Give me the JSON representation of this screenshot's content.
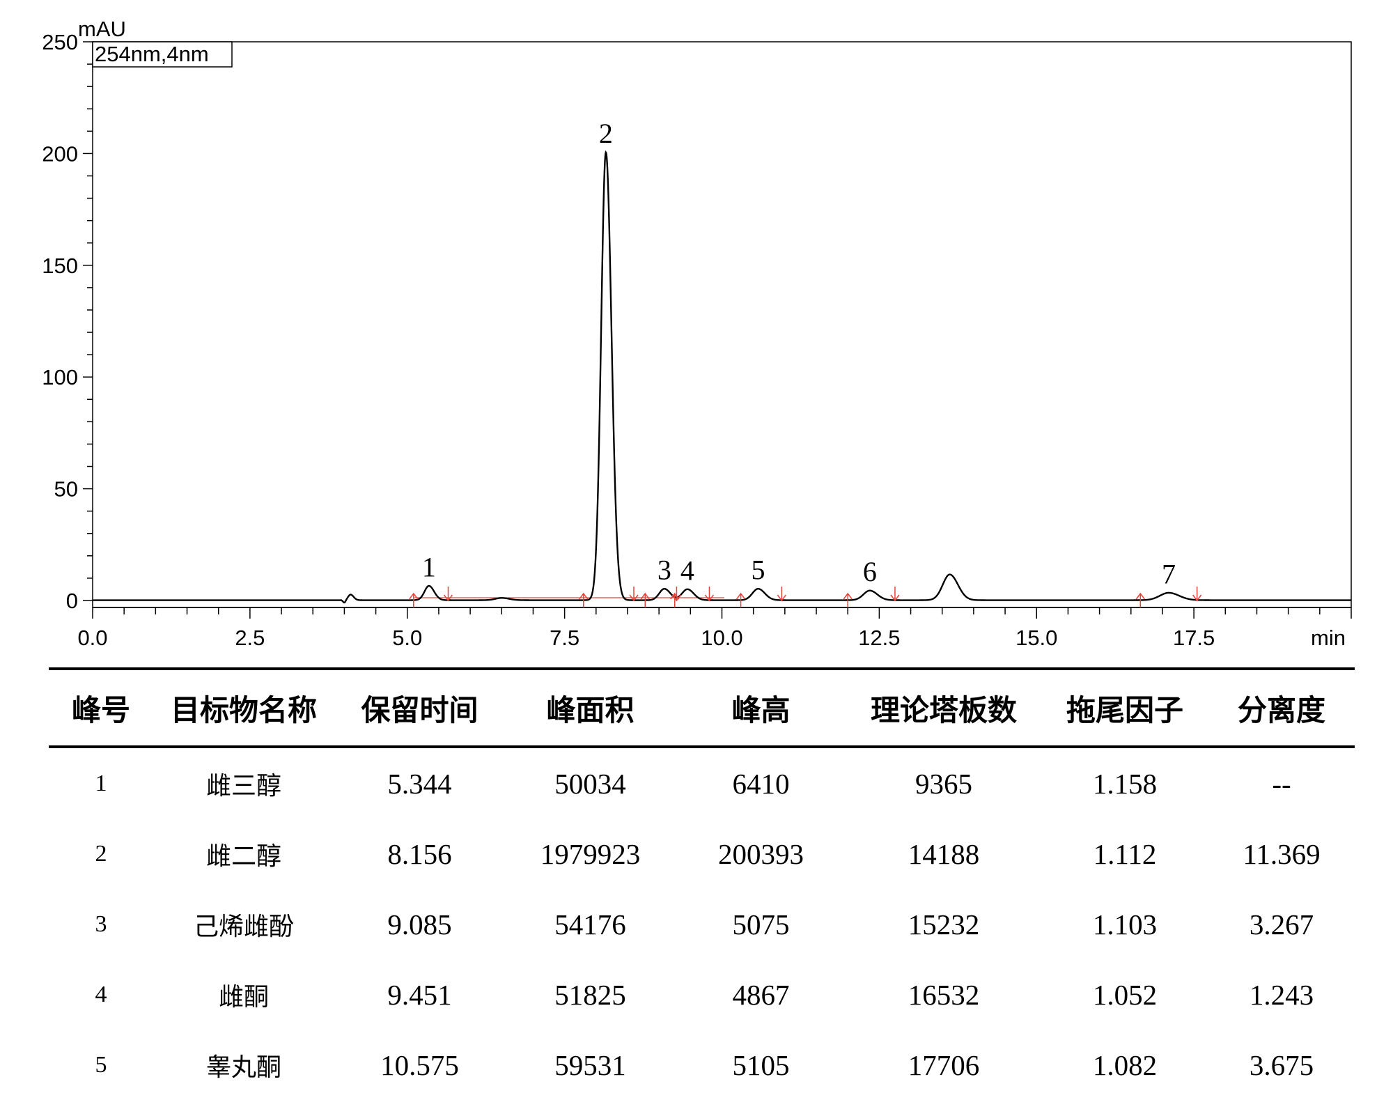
{
  "chart_data": {
    "type": "line",
    "ylabel": "mAU",
    "xlabel": "min",
    "legend": "254nm,4nm",
    "ylim": [
      0,
      250
    ],
    "xlim": [
      0,
      20
    ],
    "yticks": [
      "0",
      "50",
      "100",
      "150",
      "200",
      "250"
    ],
    "xticks": [
      "0.0",
      "2.5",
      "5.0",
      "7.5",
      "10.0",
      "12.5",
      "15.0",
      "17.5"
    ],
    "ytick_values": [
      0,
      50,
      100,
      150,
      200,
      250
    ],
    "xtick_values": [
      0,
      2.5,
      5,
      7.5,
      10,
      12.5,
      15,
      17.5
    ],
    "peaks": [
      {
        "rt": 4.1,
        "height": 2.5,
        "width": 0.04
      },
      {
        "rt": 5.344,
        "height": 6.4,
        "width": 0.07,
        "label": "1"
      },
      {
        "rt": 6.5,
        "height": 1.0,
        "width": 0.1
      },
      {
        "rt": 8.156,
        "height": 200.4,
        "width": 0.075,
        "label": "2"
      },
      {
        "rt": 9.085,
        "height": 5.1,
        "width": 0.08,
        "label": "3"
      },
      {
        "rt": 9.451,
        "height": 4.9,
        "width": 0.085,
        "label": "4"
      },
      {
        "rt": 10.575,
        "height": 5.1,
        "width": 0.09,
        "label": "5"
      },
      {
        "rt": 12.35,
        "height": 4.3,
        "width": 0.1,
        "label": "6"
      },
      {
        "rt": 13.62,
        "height": 11.5,
        "width": 0.11
      },
      {
        "rt": 17.1,
        "height": 3.3,
        "width": 0.14,
        "label": "7"
      }
    ],
    "integration_markers": [
      {
        "x": 5.1,
        "dir": "up"
      },
      {
        "x": 5.65,
        "dir": "down"
      },
      {
        "x": 7.8,
        "dir": "up"
      },
      {
        "x": 8.6,
        "dir": "down"
      },
      {
        "x": 8.78,
        "dir": "up"
      },
      {
        "x": 9.25,
        "dir": "up"
      },
      {
        "x": 9.28,
        "dir": "down"
      },
      {
        "x": 9.8,
        "dir": "down"
      },
      {
        "x": 10.3,
        "dir": "up"
      },
      {
        "x": 10.95,
        "dir": "down"
      },
      {
        "x": 12.0,
        "dir": "up"
      },
      {
        "x": 12.75,
        "dir": "down"
      },
      {
        "x": 16.65,
        "dir": "up"
      },
      {
        "x": 17.55,
        "dir": "down"
      }
    ],
    "colors": {
      "trace": "#000000",
      "marker": "#e5433a"
    }
  },
  "table": {
    "headers": [
      "峰号",
      "目标物名称",
      "保留时间",
      "峰面积",
      "峰高",
      "理论塔板数",
      "拖尾因子",
      "分离度"
    ],
    "rows": [
      [
        "1",
        "雌三醇",
        "5.344",
        "50034",
        "6410",
        "9365",
        "1.158",
        "--"
      ],
      [
        "2",
        "雌二醇",
        "8.156",
        "1979923",
        "200393",
        "14188",
        "1.112",
        "11.369"
      ],
      [
        "3",
        "己烯雌酚",
        "9.085",
        "54176",
        "5075",
        "15232",
        "1.103",
        "3.267"
      ],
      [
        "4",
        "雌酮",
        "9.451",
        "51825",
        "4867",
        "16532",
        "1.052",
        "1.243"
      ],
      [
        "5",
        "睾丸酮",
        "10.575",
        "59531",
        "5105",
        "17706",
        "1.082",
        "3.675"
      ]
    ]
  }
}
